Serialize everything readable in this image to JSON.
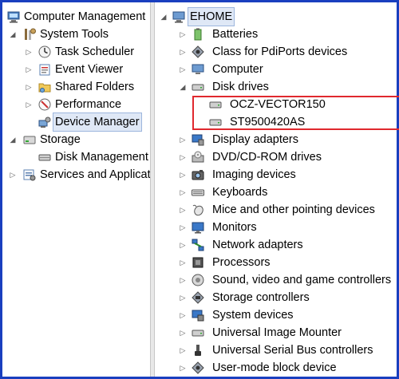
{
  "left_tree": {
    "root": "Computer Management",
    "system_tools": "System Tools",
    "task_scheduler": "Task Scheduler",
    "event_viewer": "Event Viewer",
    "shared_folders": "Shared Folders",
    "performance": "Performance",
    "device_manager": "Device Manager",
    "storage": "Storage",
    "disk_management": "Disk Management",
    "services_apps": "Services and Applications"
  },
  "device_tree": {
    "computer_name": "EHOME",
    "batteries": "Batteries",
    "pdiports": "Class for PdiPorts devices",
    "computer": "Computer",
    "disk_drives": "Disk drives",
    "disk_1": "OCZ-VECTOR150",
    "disk_2": "ST9500420AS",
    "display_adapters": "Display adapters",
    "dvd": "DVD/CD-ROM drives",
    "imaging": "Imaging devices",
    "keyboards": "Keyboards",
    "mice": "Mice and other pointing devices",
    "monitors": "Monitors",
    "network": "Network adapters",
    "processors": "Processors",
    "sound": "Sound, video and game controllers",
    "storage_ctrl": "Storage controllers",
    "system_devices": "System devices",
    "universal_image": "Universal Image Mounter",
    "usb": "Universal Serial Bus controllers",
    "user_mode": "User-mode block device"
  },
  "colors": {
    "frame_border": "#1a3fbf",
    "highlight_box": "#e0282e",
    "selection_bg": "#dfe8f6"
  }
}
